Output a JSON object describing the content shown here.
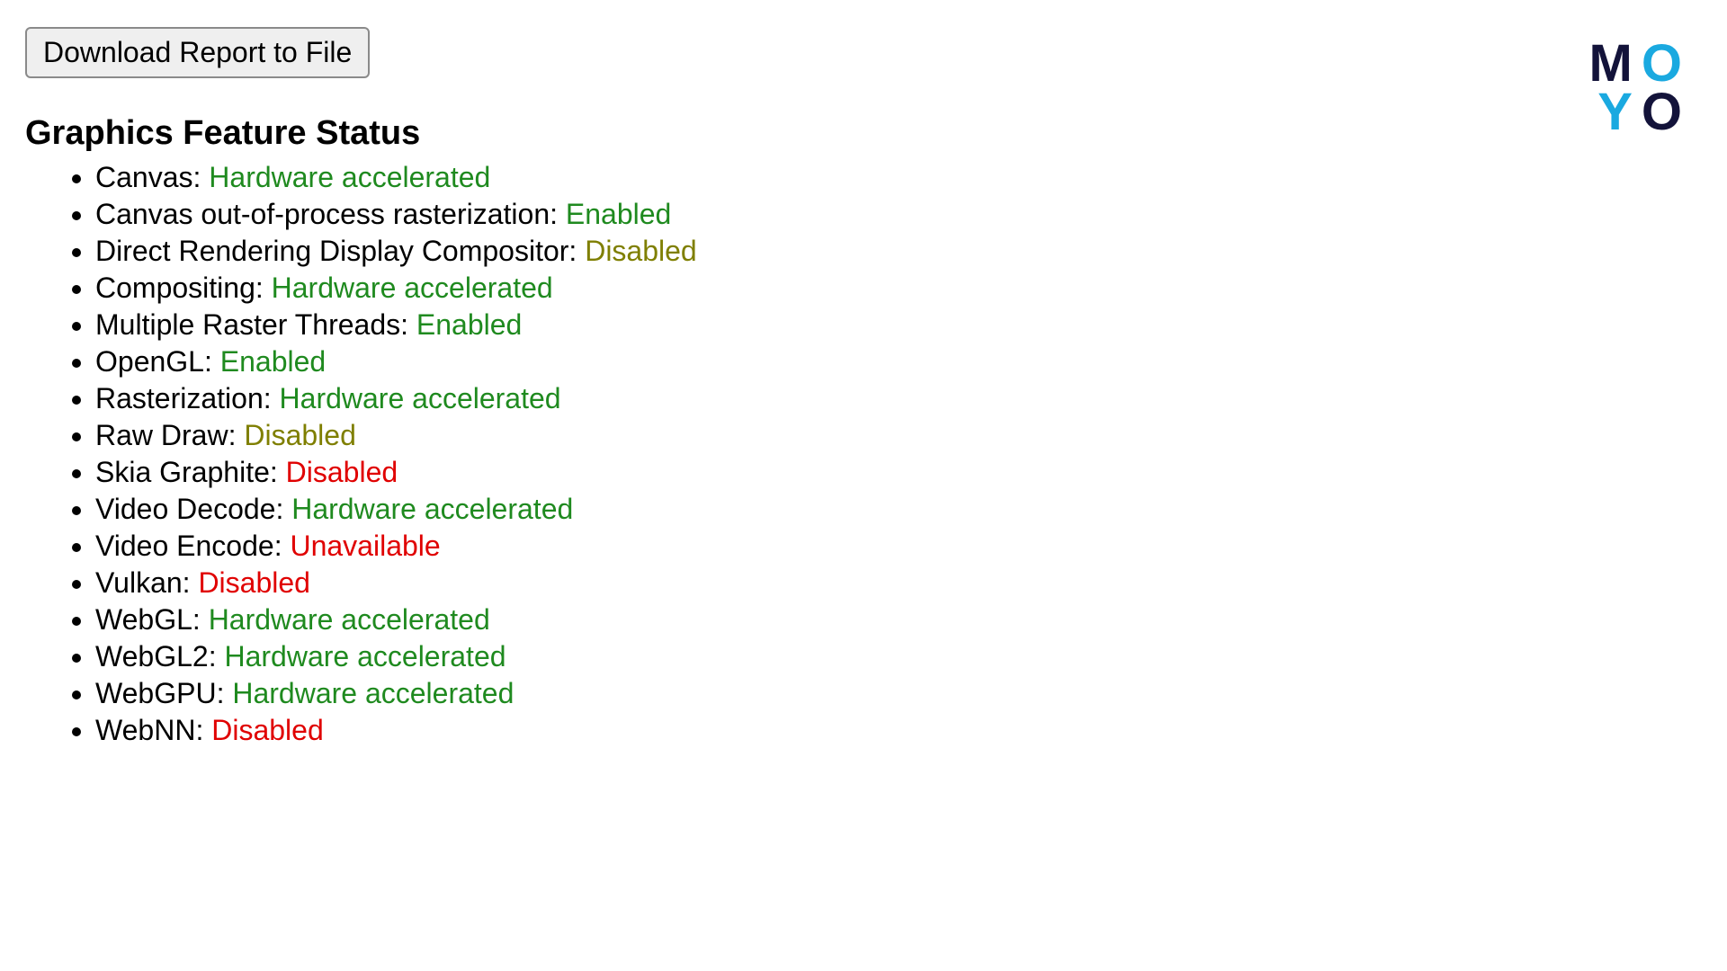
{
  "button": {
    "download_label": "Download Report to File"
  },
  "heading": "Graphics Feature Status",
  "features": [
    {
      "label": "Canvas",
      "value": "Hardware accelerated",
      "status": "green"
    },
    {
      "label": "Canvas out-of-process rasterization",
      "value": "Enabled",
      "status": "green"
    },
    {
      "label": "Direct Rendering Display Compositor",
      "value": "Disabled",
      "status": "olive"
    },
    {
      "label": "Compositing",
      "value": "Hardware accelerated",
      "status": "green"
    },
    {
      "label": "Multiple Raster Threads",
      "value": "Enabled",
      "status": "green"
    },
    {
      "label": "OpenGL",
      "value": "Enabled",
      "status": "green"
    },
    {
      "label": "Rasterization",
      "value": "Hardware accelerated",
      "status": "green"
    },
    {
      "label": "Raw Draw",
      "value": "Disabled",
      "status": "olive"
    },
    {
      "label": "Skia Graphite",
      "value": "Disabled",
      "status": "red"
    },
    {
      "label": "Video Decode",
      "value": "Hardware accelerated",
      "status": "green"
    },
    {
      "label": "Video Encode",
      "value": "Unavailable",
      "status": "red"
    },
    {
      "label": "Vulkan",
      "value": "Disabled",
      "status": "red"
    },
    {
      "label": "WebGL",
      "value": "Hardware accelerated",
      "status": "green"
    },
    {
      "label": "WebGL2",
      "value": "Hardware accelerated",
      "status": "green"
    },
    {
      "label": "WebGPU",
      "value": "Hardware accelerated",
      "status": "green"
    },
    {
      "label": "WebNN",
      "value": "Disabled",
      "status": "red"
    }
  ],
  "logo": {
    "top_left": "M",
    "top_right": "O",
    "bottom_left": "Y",
    "bottom_right": "O"
  },
  "colors": {
    "green": "#1f8a1f",
    "olive": "#7f7f00",
    "red": "#e00000",
    "logo_navy": "#13133a",
    "logo_cyan": "#1aa9e0"
  }
}
